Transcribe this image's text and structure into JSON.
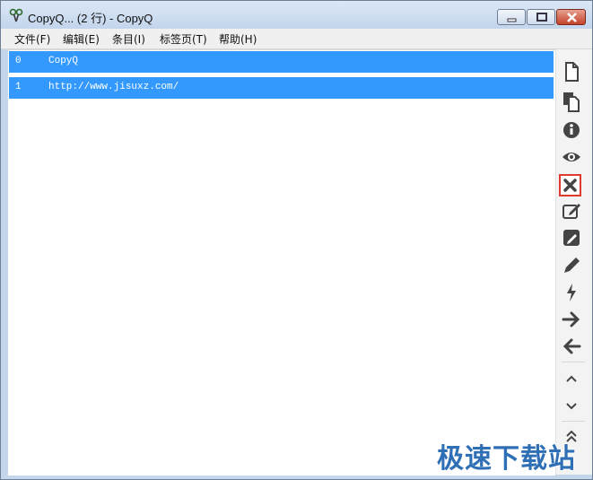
{
  "window": {
    "title": "CopyQ... (2 行) - CopyQ"
  },
  "menu": [
    {
      "label": "文件(F)"
    },
    {
      "label": "编辑(E)"
    },
    {
      "label": "条目(I)"
    },
    {
      "label": "标签页(T)"
    },
    {
      "label": "帮助(H)"
    }
  ],
  "items": [
    {
      "index": "0",
      "text": "CopyQ"
    },
    {
      "index": "1",
      "text": "http://www.jisuxz.com/"
    }
  ],
  "toolbar": {
    "icons": [
      "new-item-icon",
      "copy-icon",
      "info-icon",
      "show-icon",
      "delete-icon",
      "edit-external-icon",
      "edit-notes-icon",
      "edit-icon",
      "action-icon",
      "next-icon",
      "previous-icon",
      "move-up-icon",
      "move-down-icon",
      "move-top-icon"
    ]
  },
  "watermark": "极速下载站",
  "colors": {
    "selection": "#3399ff",
    "highlight_border": "#e03a2e"
  }
}
